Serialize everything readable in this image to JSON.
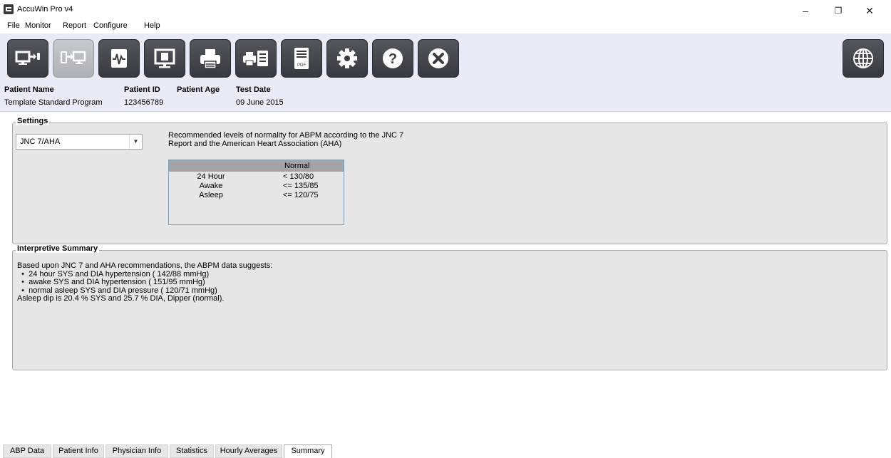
{
  "window": {
    "title": "AccuWin Pro v4",
    "controls": {
      "minimize": "–",
      "restore": "❐",
      "close": "✕"
    }
  },
  "menu": [
    "File",
    "Monitor",
    "Report",
    "Configure",
    "Help"
  ],
  "toolbar": {
    "buttons": [
      {
        "name": "monitor-to-computer-icon",
        "enabled": true
      },
      {
        "name": "computer-to-monitor-icon",
        "enabled": false
      },
      {
        "name": "waveform-icon",
        "enabled": true
      },
      {
        "name": "display-report-icon",
        "enabled": true
      },
      {
        "name": "printer-icon",
        "enabled": true
      },
      {
        "name": "print-list-icon",
        "enabled": true
      },
      {
        "name": "pdf-icon",
        "enabled": true,
        "label": "PDF"
      },
      {
        "name": "gear-icon",
        "enabled": true
      },
      {
        "name": "help-icon",
        "enabled": true
      },
      {
        "name": "close-circle-icon",
        "enabled": true
      },
      {
        "name": "globe-icon",
        "enabled": true
      }
    ]
  },
  "patient": {
    "name_label": "Patient Name",
    "name_value": "Template Standard Program",
    "id_label": "Patient ID",
    "id_value": "123456789",
    "age_label": "Patient Age",
    "age_value": "",
    "date_label": "Test Date",
    "date_value": "09 June 2015"
  },
  "settings": {
    "title": "Settings",
    "selected": "JNC 7/AHA",
    "description_line1": "Recommended levels of normality for ABPM according to the JNC 7",
    "description_line2": "Report and the American Heart Association (AHA)",
    "table_header": "Normal",
    "rows": [
      {
        "period": "24 Hour",
        "value": "<  130/80"
      },
      {
        "period": "Awake",
        "value": "<= 135/85"
      },
      {
        "period": "Asleep",
        "value": "<= 120/75"
      }
    ]
  },
  "summary": {
    "title": "Interpretive Summary",
    "lines": [
      "Based upon JNC 7 and AHA recommendations, the ABPM data suggests:",
      "  •  24 hour SYS and DIA hypertension ( 142/88 mmHg)",
      "  •  awake SYS and DIA hypertension ( 151/95 mmHg)",
      "  •  normal asleep SYS and DIA pressure ( 120/71 mmHg)",
      "Asleep dip is 20.4 % SYS and 25.7 % DIA, Dipper (normal)."
    ]
  },
  "tabs": [
    "ABP Data",
    "Patient Info",
    "Physician Info",
    "Statistics",
    "Hourly Averages",
    "Summary"
  ],
  "active_tab": "Summary",
  "colors": {
    "toolbar_bg": "#e9ebf6",
    "button_dark": "#45464b",
    "button_disabled": "#bdbec1",
    "group_bg": "#e6e6e6",
    "table_header": "#a4a4a4",
    "table_border": "#7f9db9"
  }
}
